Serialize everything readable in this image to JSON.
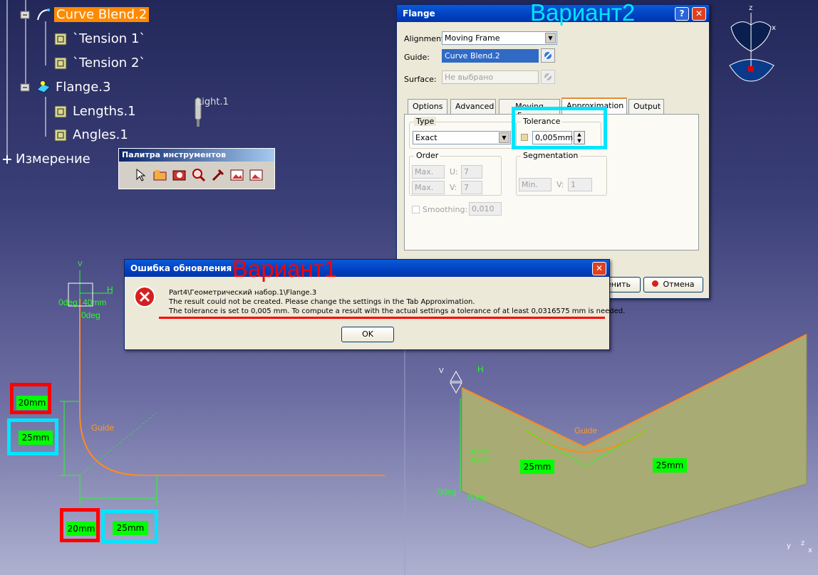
{
  "tree": {
    "curve_blend": "Curve Blend.2",
    "tension1": "`Tension 1`",
    "tension2": "`Tension 2`",
    "flange": "Flange.3",
    "lengths": "Lengths.1",
    "angles": "Angles.1",
    "measure": "Измерение"
  },
  "light_label": "Light.1",
  "palette": {
    "title": "Палитра инструментов"
  },
  "flange_dialog": {
    "title": "Flange",
    "alignment_label": "Alignment:",
    "alignment_value": "Moving Frame",
    "guide_label": "Guide:",
    "guide_value": "Curve Blend.2",
    "surface_label": "Surface:",
    "surface_value": "Не выбрано",
    "tabs": [
      "Options",
      "Advanced",
      "Moving Frame",
      "Approximation",
      "Output"
    ],
    "type_group": "Type",
    "type_value": "Exact",
    "tolerance_group": "Tolerance",
    "tolerance_value": "0,005mm",
    "order_group": "Order",
    "order_u_mode": "Max.",
    "order_v_mode": "Max.",
    "u_label": "U:",
    "u_value": "7",
    "v_label": "V:",
    "v_value": "7",
    "segmentation_group": "Segmentation",
    "seg_mode": "Min.",
    "seg_v_label": "V:",
    "seg_v_value": "1",
    "smoothing_label": "Smoothing:",
    "smoothing_value": "0,010",
    "apply_label": "енить",
    "cancel_label": "Отмена"
  },
  "error_dialog": {
    "title": "Ошибка обновления",
    "line1": "Part4\\Геометрический набор.1\\Flange.3",
    "line2": "The result could not be created. Please change the settings in the Tab Approximation.",
    "line3": "The tolerance is set to 0,005 mm. To compute a result with the actual settings a tolerance of at least 0,0316575 mm is needed.",
    "ok_label": "OK"
  },
  "annotations": {
    "variant1": "Вариант1",
    "variant2": "Вариант2",
    "variant1_color": "#ff0000",
    "variant2_color": "#00e5ff"
  },
  "sketch_left": {
    "axis_v": "V",
    "axis_h": "H",
    "odeg_a": "0deg",
    "len_a": "40mm",
    "odeg_b": "0deg",
    "guide": "Guide",
    "dim_red_v": "20mm",
    "dim_cyan_v": "25mm",
    "dim_red_h": "20mm",
    "dim_cyan_h": "25mm"
  },
  "sketch_right": {
    "axis_v": "V",
    "axis_h": "H",
    "guide": "Guide",
    "dim_a": "25mm",
    "dim_b": "25mm",
    "len_a": "40mm",
    "len_b": "40mm",
    "odeg_a": "0deg",
    "odeg_b": "0deg"
  },
  "compass": {
    "z": "z",
    "x": "x"
  },
  "axes_small": {
    "y": "y",
    "z": "z",
    "x": "x"
  }
}
